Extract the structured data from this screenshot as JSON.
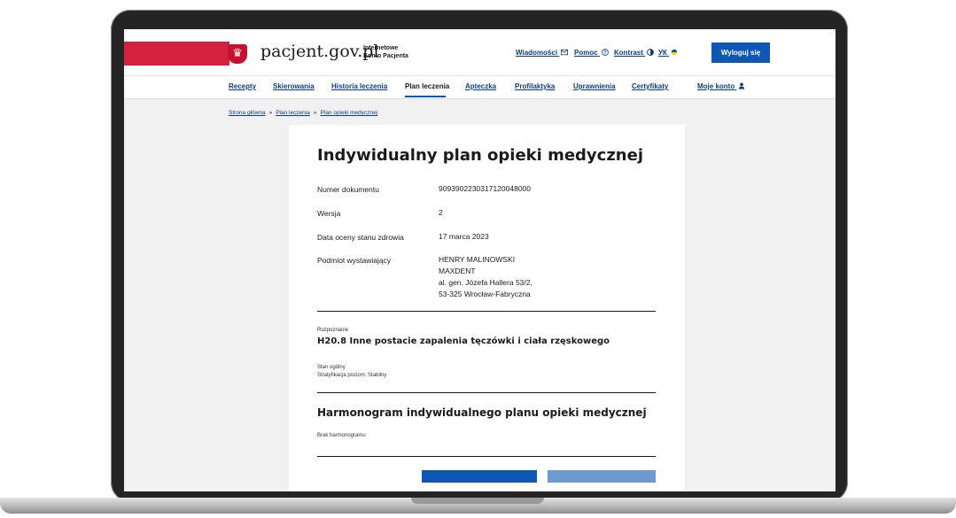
{
  "site": {
    "logo": "pacjent.gov.pl",
    "logo_sub_line1": "Internetowe",
    "logo_sub_line2": "Konto Pacjenta",
    "emblem_icon": "polish-eagle-icon"
  },
  "top_links": {
    "messages": "Wiadomości",
    "help": "Pomoc",
    "contrast": "Kontrast",
    "language": "УК",
    "logout": "Wyloguj się"
  },
  "nav": {
    "items": [
      "Recepty",
      "Skierowania",
      "Historia leczenia",
      "Plan leczenia",
      "Apteczka",
      "Profilaktyka",
      "Uprawnienia",
      "Certyfikaty"
    ],
    "active": "Plan leczenia",
    "account": "Moje konto"
  },
  "breadcrumb": [
    "Strona główna",
    "Plan leczenia",
    "Plan opieki medycznej"
  ],
  "breadcrumb_separator": "»",
  "document": {
    "title": "Indywidualny plan opieki medycznej",
    "fields": [
      {
        "label": "Numer dokumentu",
        "value": "9093902230317120048000"
      },
      {
        "label": "Wersja",
        "value": "2"
      },
      {
        "label": "Data oceny stanu zdrowia",
        "value": "17 marca 2023"
      }
    ],
    "issuer_label": "Podmiot wystawiający",
    "issuer_lines": [
      "HENRY MALINOWSKI",
      "MAXDENT",
      "al. gen. Józefa Hallera 53/2,",
      "53-325 Wrocław-Fabryczna"
    ],
    "diagnosis_label": "Rozpoznanie",
    "diagnosis": "H20.8 Inne postacie zapalenia tęczówki i ciała rzęskowego",
    "state_label": "Stan ogólny",
    "state_value": "Stratyfikacja poziom: Stabilny",
    "schedule_title": "Harmonogram indywidualnego planu opieki medycznej",
    "schedule_empty": "Brak harmonogramu"
  },
  "colors": {
    "brand_red": "#d4213d",
    "link_blue": "#0b3d91",
    "button_blue": "#0e57b4"
  }
}
